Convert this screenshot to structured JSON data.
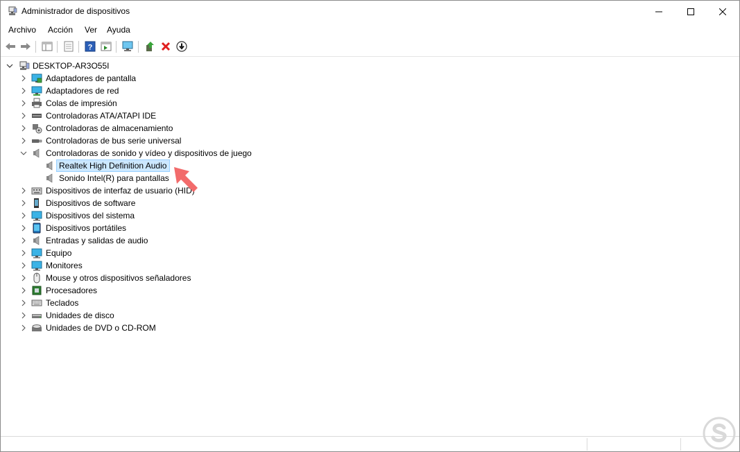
{
  "window": {
    "title": "Administrador de dispositivos"
  },
  "menu": [
    "Archivo",
    "Acción",
    "Ver",
    "Ayuda"
  ],
  "toolbar": [
    "back-icon",
    "forward-icon",
    "console-tree-icon",
    "properties-icon",
    "help-icon",
    "action-pane-icon",
    "scan-hardware-icon",
    "update-driver-icon",
    "uninstall-icon",
    "disable-icon"
  ],
  "tree": {
    "root": "DESKTOP-AR3O55I",
    "categories": [
      "Adaptadores de pantalla",
      "Adaptadores de red",
      "Colas de impresión",
      "Controladoras ATA/ATAPI IDE",
      "Controladoras de almacenamiento",
      "Controladoras de bus serie universal",
      "Controladoras de sonido y vídeo y dispositivos de juego"
    ],
    "sound_children": [
      "Realtek High Definition Audio",
      "Sonido Intel(R) para pantallas"
    ],
    "categories_after": [
      "Dispositivos de interfaz de usuario (HID)",
      "Dispositivos de software",
      "Dispositivos del sistema",
      "Dispositivos portátiles",
      "Entradas y salidas de audio",
      "Equipo",
      "Monitores",
      "Mouse y otros dispositivos señaladores",
      "Procesadores",
      "Teclados",
      "Unidades de disco",
      "Unidades de DVD o CD-ROM"
    ]
  },
  "colors": {
    "selection": "#cce8ff",
    "arrow": "#f26b6b",
    "watermark": "#d9d9d9"
  }
}
